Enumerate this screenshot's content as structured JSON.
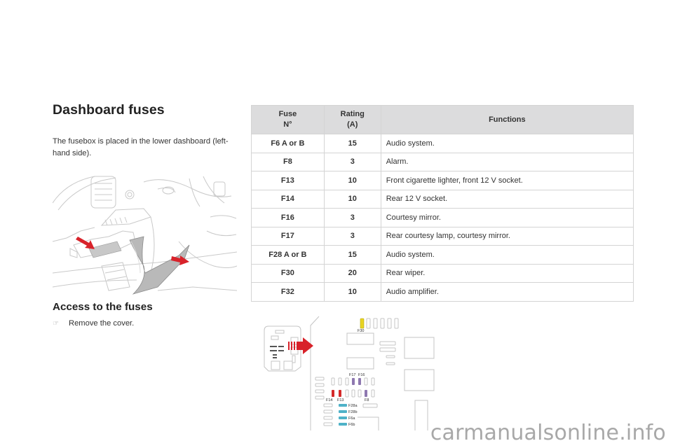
{
  "section": {
    "title": "Dashboard fuses",
    "intro": "The fusebox is placed in the lower dashboard (left-hand side).",
    "access_title": "Access to the fuses",
    "steps": [
      {
        "icon": "pointing-hand-icon",
        "glyph": "☞",
        "text": "Remove the cover."
      }
    ]
  },
  "fuse_table": {
    "headers": {
      "fuse_line1": "Fuse",
      "fuse_line2": "N°",
      "rating_line1": "Rating",
      "rating_line2": "(A)",
      "functions": "Functions"
    },
    "rows": [
      {
        "fuse": "F6 A or B",
        "rating": "15",
        "function": "Audio system."
      },
      {
        "fuse": "F8",
        "rating": "3",
        "function": "Alarm."
      },
      {
        "fuse": "F13",
        "rating": "10",
        "function": "Front cigarette lighter, front 12 V socket."
      },
      {
        "fuse": "F14",
        "rating": "10",
        "function": "Rear 12 V socket."
      },
      {
        "fuse": "F16",
        "rating": "3",
        "function": "Courtesy mirror."
      },
      {
        "fuse": "F17",
        "rating": "3",
        "function": "Rear courtesy lamp, courtesy mirror."
      },
      {
        "fuse": "F28 A or B",
        "rating": "15",
        "function": "Audio system."
      },
      {
        "fuse": "F30",
        "rating": "20",
        "function": "Rear wiper."
      },
      {
        "fuse": "F32",
        "rating": "10",
        "function": "Audio amplifier."
      }
    ]
  },
  "diagram": {
    "labels": {
      "f30": "F30",
      "f17": "F17",
      "f16": "F16",
      "f14": "F14",
      "f13": "F13",
      "f8": "F8",
      "f28a": "F28a",
      "f28b": "F28b",
      "f6a": "F6a",
      "f6b": "F6b"
    },
    "colors": {
      "yellow": "#e8d422",
      "red": "#d42a2a",
      "purple": "#8e78b0",
      "blue": "#4fb2c8",
      "arrow": "#d8222a",
      "outline": "#bfbfbf"
    }
  },
  "watermark": "carmanualsonline.info"
}
